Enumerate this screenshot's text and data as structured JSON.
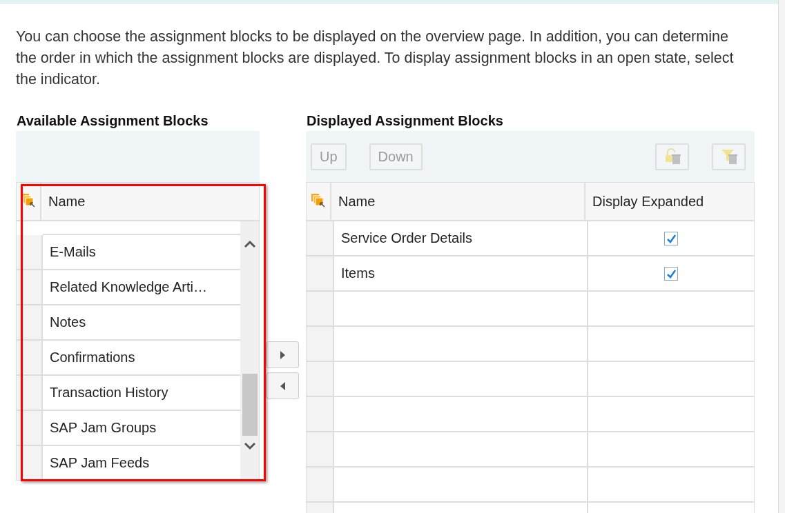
{
  "intro": "You can choose the assignment blocks to be displayed on the overview page. In addition, you can determine the order in which the assignment blocks are displayed. To display assignment blocks in an open state, select the indicator.",
  "available": {
    "title": "Available Assignment Blocks",
    "columns": [
      "Name"
    ],
    "rows": [
      {
        "name": "E-Mails"
      },
      {
        "name": "Related Knowledge Arti…"
      },
      {
        "name": "Notes"
      },
      {
        "name": "Confirmations"
      },
      {
        "name": "Transaction History"
      },
      {
        "name": "SAP Jam Groups"
      },
      {
        "name": "SAP Jam Feeds"
      }
    ],
    "annotation": {
      "kind": "highlight-frame"
    }
  },
  "move_buttons": [
    {
      "kind": "right"
    },
    {
      "kind": "left"
    }
  ],
  "displayed": {
    "title": "Displayed Assignment Blocks",
    "toolbar": [
      {
        "kind": "text",
        "label": "Up",
        "disabled": true
      },
      {
        "kind": "text",
        "label": "Down",
        "disabled": true
      },
      {
        "kind": "lock-delete",
        "disabled": true
      },
      {
        "kind": "filter-delete",
        "disabled": true
      }
    ],
    "columns": [
      "Name",
      "Display Expanded"
    ],
    "rows": [
      {
        "name": "Service Order Details",
        "expanded": true
      },
      {
        "name": "Items",
        "expanded": true
      }
    ]
  }
}
